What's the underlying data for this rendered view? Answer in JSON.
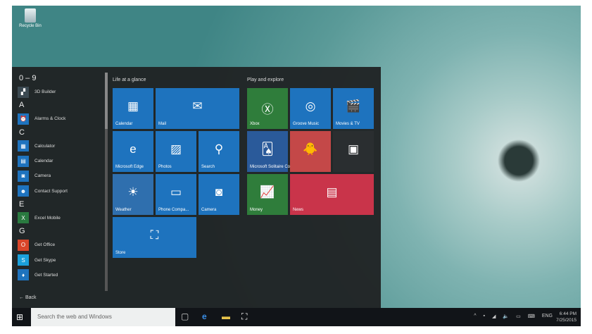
{
  "desktop": {
    "recycle_bin": "Recycle Bin"
  },
  "start": {
    "sections": [
      {
        "letter": "0 – 9",
        "apps": [
          {
            "label": "3D Builder",
            "icon": "cube-icon",
            "color": "#3c4a52",
            "glyph": "▞"
          }
        ]
      },
      {
        "letter": "A",
        "apps": [
          {
            "label": "Alarms & Clock",
            "icon": "clock-icon",
            "color": "#1e73be",
            "glyph": "⏰"
          }
        ]
      },
      {
        "letter": "C",
        "apps": [
          {
            "label": "Calculator",
            "icon": "calculator-icon",
            "color": "#1e73be",
            "glyph": "▦"
          },
          {
            "label": "Calendar",
            "icon": "calendar-icon",
            "color": "#1e73be",
            "glyph": "▤"
          },
          {
            "label": "Camera",
            "icon": "camera-icon",
            "color": "#1e73be",
            "glyph": "◙"
          },
          {
            "label": "Contact Support",
            "icon": "person-icon",
            "color": "#1e73be",
            "glyph": "☻"
          }
        ]
      },
      {
        "letter": "E",
        "apps": [
          {
            "label": "Excel Mobile",
            "icon": "excel-icon",
            "color": "#2a7a40",
            "glyph": "X"
          }
        ]
      },
      {
        "letter": "G",
        "apps": [
          {
            "label": "Get Office",
            "icon": "office-icon",
            "color": "#d9452a",
            "glyph": "O"
          },
          {
            "label": "Get Skype",
            "icon": "skype-icon",
            "color": "#1aa0db",
            "glyph": "S"
          },
          {
            "label": "Get Started",
            "icon": "lightbulb-icon",
            "color": "#1e73be",
            "glyph": "♦"
          }
        ]
      }
    ],
    "back": "Back",
    "group1": "Life at a glance",
    "group2": "Play and explore",
    "tiles": [
      {
        "label": "Calendar",
        "glyph": "▦",
        "color": "#1e73be",
        "icon": "calendar-icon"
      },
      {
        "label": "Mail",
        "glyph": "✉",
        "color": "#1e73be",
        "icon": "mail-icon"
      },
      {
        "label": "Microsoft Edge",
        "glyph": "e",
        "color": "#1e73be",
        "icon": "edge-icon"
      },
      {
        "label": "Photos",
        "glyph": "▨",
        "color": "#1e73be",
        "icon": "photos-icon"
      },
      {
        "label": "Search",
        "glyph": "⚲",
        "color": "#1e73be",
        "icon": "search-icon"
      },
      {
        "label": "Weather",
        "glyph": "☀",
        "color": "#2f6fae",
        "icon": "sun-icon"
      },
      {
        "label": "Phone Compa...",
        "glyph": "▭",
        "color": "#1e73be",
        "icon": "phone-companion-icon"
      },
      {
        "label": "Camera",
        "glyph": "◙",
        "color": "#1e73be",
        "icon": "camera-icon"
      },
      {
        "label": "Store",
        "glyph": "⛶",
        "color": "#1e73be",
        "icon": "store-icon"
      },
      {
        "label": "Xbox",
        "glyph": "Ⓧ",
        "color": "#2f7d3b",
        "icon": "xbox-icon"
      },
      {
        "label": "Groove Music",
        "glyph": "◎",
        "color": "#1e73be",
        "icon": "music-icon"
      },
      {
        "label": "Movies & TV",
        "glyph": "🎬",
        "color": "#1e73be",
        "icon": "film-icon"
      },
      {
        "label": "Microsoft Solitaire Collection",
        "glyph": "🂡",
        "color": "#2a5a9a",
        "icon": "cards-icon"
      },
      {
        "label": "",
        "glyph": "🐥",
        "color": "#c44848",
        "icon": "game-icon"
      },
      {
        "label": "",
        "glyph": "▣",
        "color": "#2a2e30",
        "icon": "store-apps-icon"
      },
      {
        "label": "Money",
        "glyph": "📈",
        "color": "#2f7d3b",
        "icon": "chart-icon"
      },
      {
        "label": "News",
        "glyph": "▤",
        "color": "#c9344a",
        "icon": "news-icon"
      }
    ]
  },
  "taskbar": {
    "search_placeholder": "Search the web and Windows",
    "language": "ENG",
    "time": "6:44 PM",
    "date": "7/25/2015"
  }
}
